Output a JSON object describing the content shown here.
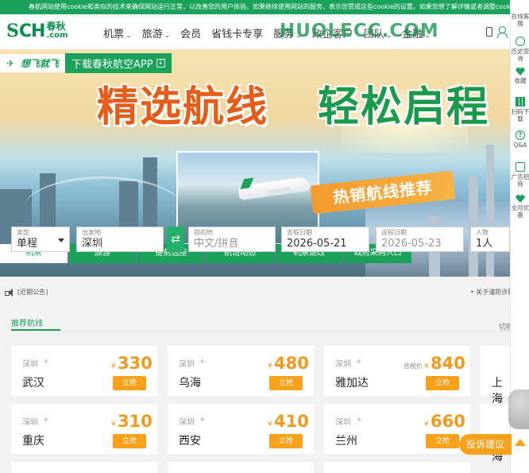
{
  "cookie_notice": "春航网站使用cookie和类似的技术来确保网站运行正常，以改善您的用户体验。如果继续使用网站的服务，表示您赞成这些cookie的设置。如果您想了解详情或者调整cookie设置",
  "brand": {
    "ch": "CH",
    "cn_top": "春秋",
    "cn_bottom": ".com",
    "mark": "S"
  },
  "nav": {
    "items": [
      {
        "label": "机票",
        "chevron": true
      },
      {
        "label": "旅游",
        "chevron": true
      },
      {
        "label": "会员",
        "chevron": false
      },
      {
        "label": "省钱卡专享",
        "chevron": false
      },
      {
        "label": "服务",
        "chevron": true
      },
      {
        "label": "政企客户",
        "chevron": false
      },
      {
        "label": "团队",
        "chevron": true
      },
      {
        "label": "金融",
        "chevron": true
      }
    ],
    "watermark": "HUOLECC.COM"
  },
  "banner": {
    "logo_text": "想飞就飞",
    "download_text": "下载春秋航空APP",
    "headline_left": "精选航线",
    "headline_right": "轻松启程",
    "ribbon": "热销航线推荐"
  },
  "booking": {
    "tabs": [
      {
        "label": "机票",
        "active": true
      },
      {
        "label": "旅游",
        "active": false
      },
      {
        "label": "提前选座",
        "active": false
      },
      {
        "label": "航班动态",
        "active": false
      },
      {
        "label": "机票退改",
        "active": false
      },
      {
        "label": "政府采购入口",
        "active": false
      }
    ],
    "trip_type": {
      "label": "类型",
      "value": "单程"
    },
    "origin": {
      "label": "出发地",
      "value": "深圳"
    },
    "destination": {
      "label": "目的地",
      "placeholder": "中文/拼音"
    },
    "depart_date": {
      "label": "去程日期",
      "value": "2026-05-21"
    },
    "return_date": {
      "label": "返程日期",
      "value": "2026-05-23"
    },
    "passengers": {
      "label": "人数",
      "value": "1人"
    },
    "swap_icon": "⇄"
  },
  "notice": {
    "text": "[近期公告]",
    "right_text": "• 关于谨防诈骗"
  },
  "recommend": {
    "title": "推荐航线",
    "switch_city": "切换出",
    "buy_label": "立抢",
    "currency": "¥",
    "tax_label": "含税价",
    "routes": [
      {
        "from": "深圳",
        "to": "武汉",
        "price": "330",
        "tax": false
      },
      {
        "from": "深圳",
        "to": "乌海",
        "price": "480",
        "tax": false
      },
      {
        "from": "深圳",
        "to": "雅加达",
        "price": "840",
        "tax": true
      },
      {
        "from": "深圳",
        "to": "上海",
        "price": "",
        "tax": false
      },
      {
        "from": "深圳",
        "to": "重庆",
        "price": "310",
        "tax": false
      },
      {
        "from": "深圳",
        "to": "西安",
        "price": "410",
        "tax": false
      },
      {
        "from": "深圳",
        "to": "兰州",
        "price": "660",
        "tax": false
      },
      {
        "from": "深圳",
        "to": "上海",
        "price": "",
        "tax": false
      }
    ]
  },
  "sidebar": {
    "items": [
      {
        "label": "在线客服",
        "icon": "service-icon"
      },
      {
        "label": "历史查询",
        "icon": "history-icon"
      },
      {
        "label": "收藏",
        "icon": "heart-icon"
      },
      {
        "label": "扫码下载",
        "icon": "qr-icon"
      },
      {
        "label": "Q&A",
        "icon": "question-icon"
      },
      {
        "label": "广告招商",
        "icon": "ad-icon"
      },
      {
        "label": "全月优惠",
        "icon": "discount-icon"
      }
    ]
  },
  "feedback_label": "投诉建议",
  "colors": {
    "brand_green": "#1aa15a",
    "price_orange": "#f39a1e",
    "cta_orange": "#f7a21a"
  }
}
